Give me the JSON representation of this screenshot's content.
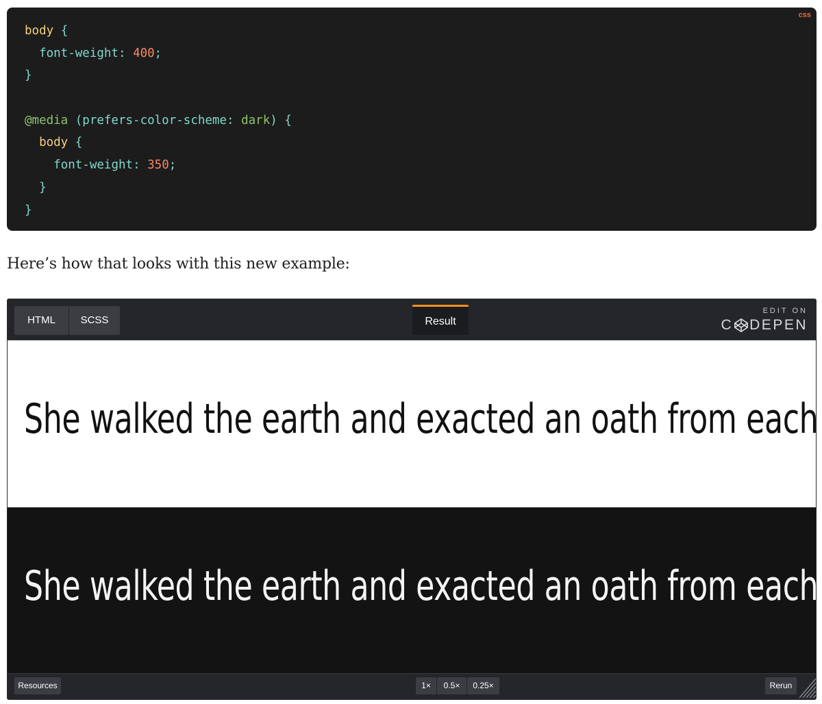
{
  "code_block": {
    "language": "css",
    "lines": [
      [
        {
          "t": "selector",
          "v": "body"
        },
        {
          "t": "punct",
          "v": " {"
        }
      ],
      [
        {
          "t": "indent",
          "v": "  "
        },
        {
          "t": "prop",
          "v": "font-weight"
        },
        {
          "t": "punct",
          "v": ": "
        },
        {
          "t": "num",
          "v": "400"
        },
        {
          "t": "punct",
          "v": ";"
        }
      ],
      [
        {
          "t": "brace",
          "v": "}"
        }
      ],
      [],
      [
        {
          "t": "at",
          "v": "@media"
        },
        {
          "t": "paren",
          "v": " (prefers-color-scheme: "
        },
        {
          "t": "kw",
          "v": "dark"
        },
        {
          "t": "paren",
          "v": ") {"
        }
      ],
      [
        {
          "t": "indent",
          "v": "  "
        },
        {
          "t": "selector",
          "v": "body"
        },
        {
          "t": "punct",
          "v": " {"
        }
      ],
      [
        {
          "t": "indent",
          "v": "    "
        },
        {
          "t": "prop",
          "v": "font-weight"
        },
        {
          "t": "punct",
          "v": ": "
        },
        {
          "t": "num",
          "v": "350"
        },
        {
          "t": "punct",
          "v": ";"
        }
      ],
      [
        {
          "t": "indent",
          "v": "  "
        },
        {
          "t": "brace",
          "v": "}"
        }
      ],
      [
        {
          "t": "brace",
          "v": "}"
        }
      ]
    ]
  },
  "paragraph": "Here’s how that looks with this new example:",
  "embed": {
    "tabs": {
      "html": "HTML",
      "scss": "SCSS",
      "result": "Result"
    },
    "edit_on": "EDIT ON",
    "codepen_brand": {
      "pre": "C",
      "post": "DEPEN"
    },
    "sample_light": "She walked the earth and exacted an oath from each thing",
    "sample_dark": "She walked the earth and exacted an oath from each thing",
    "footer": {
      "resources": "Resources",
      "zoom_1": "1×",
      "zoom_05": "0.5×",
      "zoom_025": "0.25×",
      "rerun": "Rerun"
    }
  }
}
